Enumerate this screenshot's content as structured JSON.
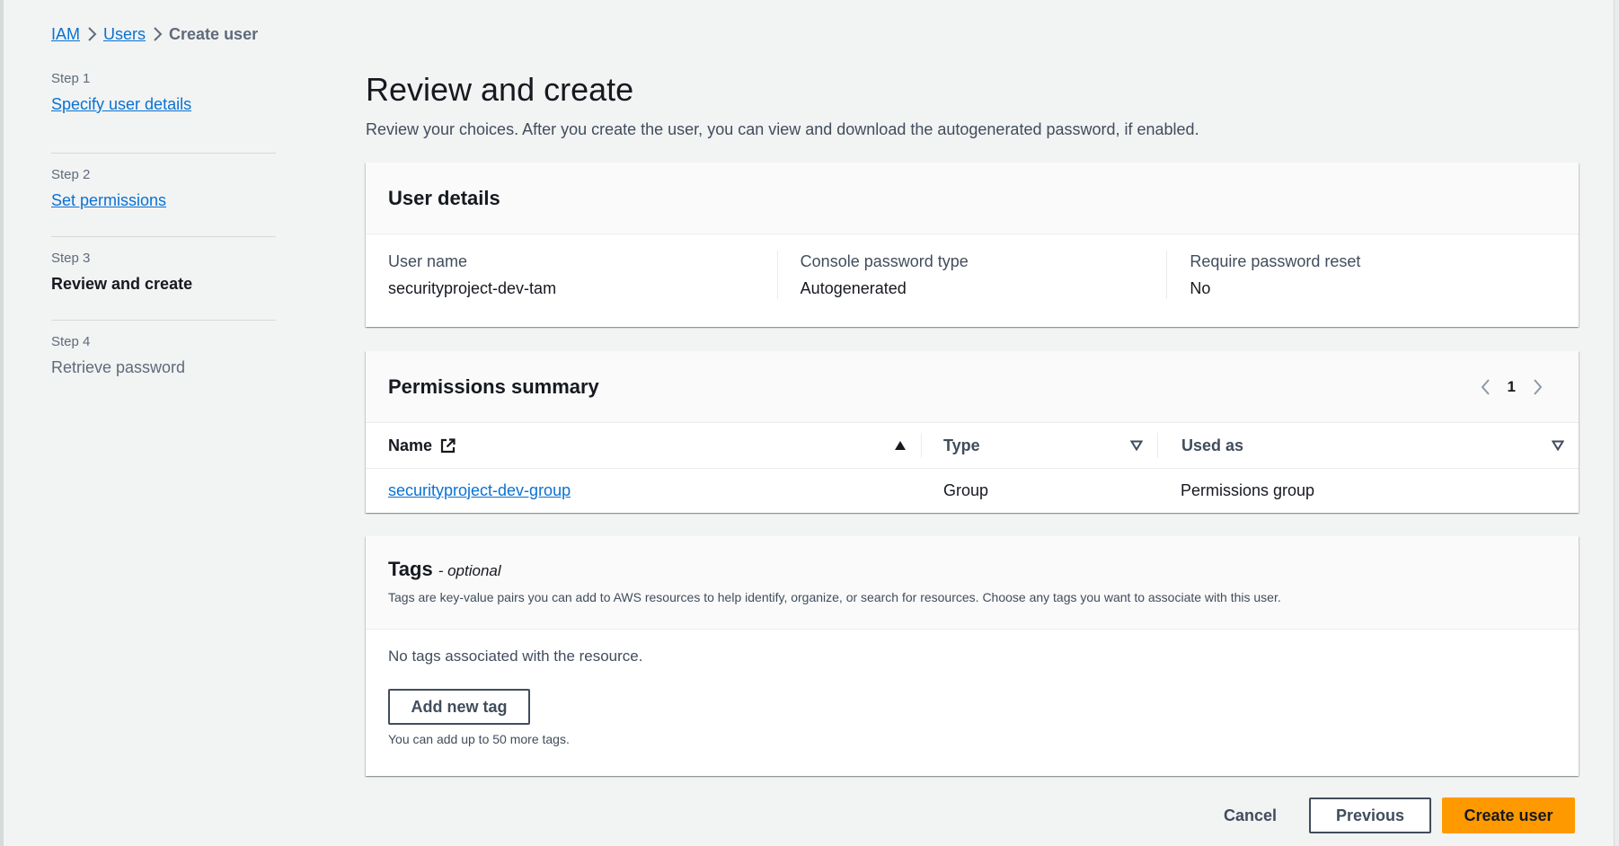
{
  "breadcrumb": {
    "items": [
      "IAM",
      "Users"
    ],
    "current": "Create user"
  },
  "steps": [
    {
      "num": "Step 1",
      "label": "Specify user details",
      "state": "link"
    },
    {
      "num": "Step 2",
      "label": "Set permissions",
      "state": "link"
    },
    {
      "num": "Step 3",
      "label": "Review and create",
      "state": "active"
    },
    {
      "num": "Step 4",
      "label": "Retrieve password",
      "state": "disabled"
    }
  ],
  "page": {
    "title": "Review and create",
    "description": "Review your choices. After you create the user, you can view and download the autogenerated password, if enabled."
  },
  "user_details": {
    "title": "User details",
    "fields": [
      {
        "key": "User name",
        "value": "securityproject-dev-tam"
      },
      {
        "key": "Console password type",
        "value": "Autogenerated"
      },
      {
        "key": "Require password reset",
        "value": "No"
      }
    ]
  },
  "permissions": {
    "title": "Permissions summary",
    "page_number": "1",
    "columns": [
      "Name",
      "Type",
      "Used as"
    ],
    "rows": [
      {
        "name": "securityproject-dev-group",
        "type": "Group",
        "used_as": "Permissions group"
      }
    ]
  },
  "tags": {
    "title": "Tags",
    "optional": "- optional",
    "description": "Tags are key-value pairs you can add to AWS resources to help identify, organize, or search for resources. Choose any tags you want to associate with this user.",
    "empty_text": "No tags associated with the resource.",
    "add_button": "Add new tag",
    "limit_text": "You can add up to 50 more tags."
  },
  "actions": {
    "cancel": "Cancel",
    "previous": "Previous",
    "create": "Create user"
  },
  "colors": {
    "link": "#0972d3",
    "primary_button": "#ff9900",
    "background": "#f2f3f3"
  }
}
